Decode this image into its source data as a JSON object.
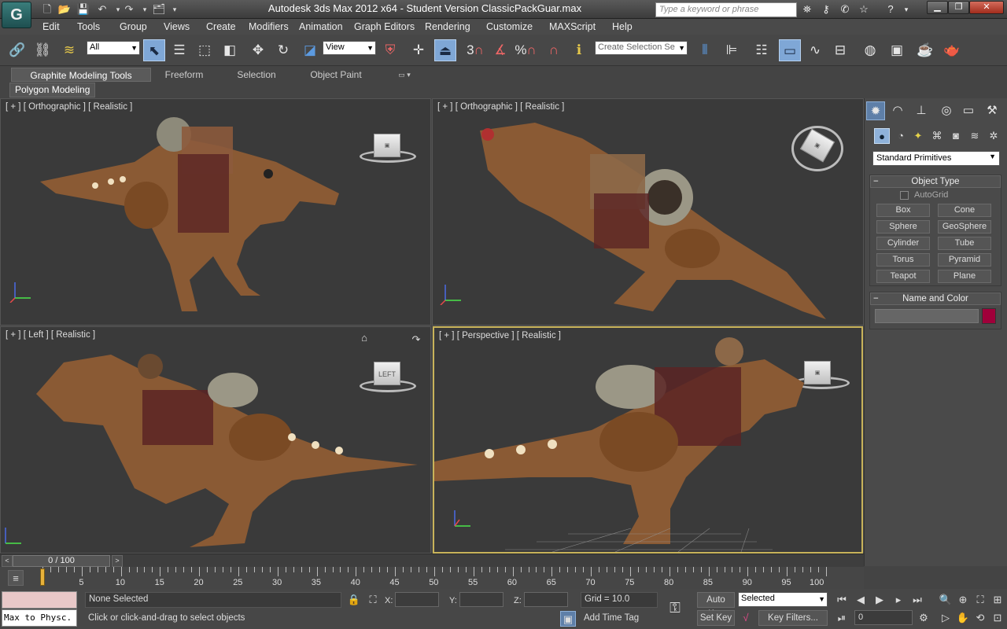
{
  "window": {
    "title": "Autodesk 3ds Max  2012 x64  -  Student Version    ClassicPackGuar.max",
    "logo_text": "G",
    "search_placeholder": "Type a keyword or phrase"
  },
  "menu": [
    "Edit",
    "Tools",
    "Group",
    "Views",
    "Create",
    "Modifiers",
    "Animation",
    "Graph Editors",
    "Rendering",
    "Customize",
    "MAXScript",
    "Help"
  ],
  "toolbar": {
    "selection_filter": "All",
    "ref_coord": "View",
    "named_selection_placeholder": "Create Selection Se",
    "snap_label_3": "3",
    "percent_snap": "%"
  },
  "ribbon": {
    "tabs": [
      "Graphite Modeling Tools",
      "Freeform",
      "Selection",
      "Object Paint"
    ],
    "panel_label": "Polygon Modeling"
  },
  "viewports": {
    "top_left": {
      "label": "[ + ] [ Orthographic ] [ Realistic ]"
    },
    "top_right": {
      "label": "[ + ] [ Orthographic ] [ Realistic ]"
    },
    "bottom_left": {
      "label": "[ + ] [ Left ] [ Realistic ]",
      "cube_text": "LEFT"
    },
    "bottom_right": {
      "label": "[ + ] [ Perspective ] [ Realistic ]"
    }
  },
  "command_panel": {
    "category": "Standard Primitives",
    "object_type": {
      "title": "Object Type",
      "autogrid": "AutoGrid",
      "buttons": [
        "Box",
        "Cone",
        "Sphere",
        "GeoSphere",
        "Cylinder",
        "Tube",
        "Torus",
        "Pyramid",
        "Teapot",
        "Plane"
      ]
    },
    "name_color": {
      "title": "Name and Color",
      "swatch_color": "#a0003a"
    }
  },
  "timeline": {
    "slider_text": "0 / 100",
    "ticks": [
      "5",
      "10",
      "15",
      "20",
      "25",
      "30",
      "35",
      "40",
      "45",
      "50",
      "55",
      "60",
      "65",
      "70",
      "75",
      "80",
      "85",
      "90",
      "95",
      "100"
    ],
    "tick_zero": "0"
  },
  "status": {
    "maxscript": "Max to Physc.",
    "selection": "None Selected",
    "prompt": "Click or click-and-drag to select objects",
    "x_label": "X:",
    "y_label": "Y:",
    "z_label": "Z:",
    "grid": "Grid = 10.0",
    "add_time_tag": "Add Time Tag",
    "auto_key": "Auto Key",
    "set_key": "Set Key",
    "selected_dd": "Selected",
    "key_filters": "Key Filters...",
    "frame": "0"
  },
  "colors": {
    "accent_active": "#7fa7d6",
    "viewport_active_border": "#c8b35a",
    "time_thumb": "#e8b23a"
  }
}
